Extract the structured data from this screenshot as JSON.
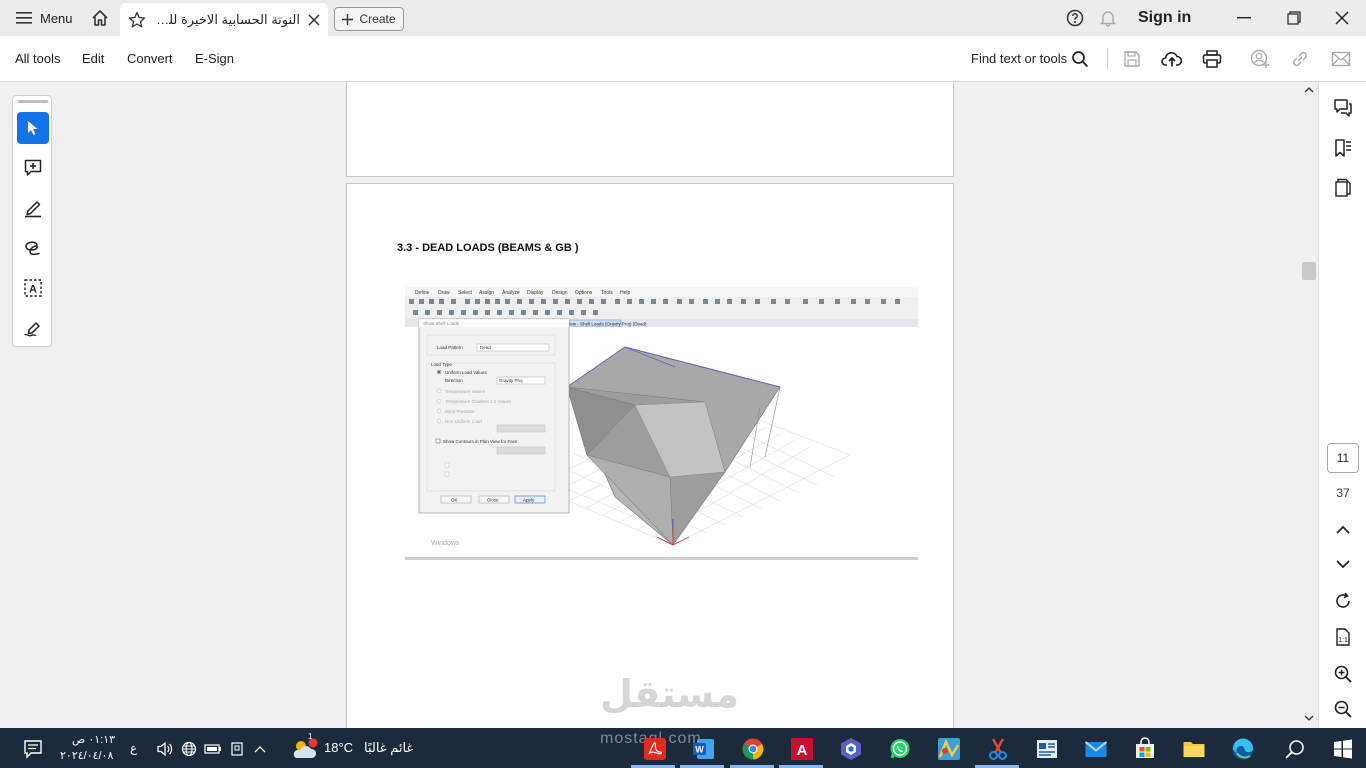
{
  "titlebar": {
    "menu_label": "Menu",
    "tab_title": "النوتة الحسابية الاخيرة للخيمة...",
    "create_label": "Create",
    "signin_label": "Sign in"
  },
  "toolbar": {
    "items": [
      "All tools",
      "Edit",
      "Convert",
      "E-Sign"
    ],
    "find_label": "Find text or tools"
  },
  "document": {
    "heading": "3.3 - DEAD LOADS (BEAMS & GB )",
    "figure": {
      "menu": [
        "Define",
        "Draw",
        "Select",
        "Assign",
        "Analyze",
        "Display",
        "Design",
        "Options",
        "Tools",
        "Help"
      ],
      "dialog_title": "Show Shell Loads",
      "load_pattern_label": "Load Pattern",
      "load_pattern_value": "Dead",
      "load_type_label": "Load Type",
      "uniform_label": "Uniform Load Values",
      "direction_label": "Direction",
      "direction_value": "Gravity Proj",
      "options": [
        "Temperature Values",
        "Temperature Gradient 2-2 Values",
        "Wind Pressure",
        "Non-Uniform Load"
      ],
      "contours_label": "Show Contours in Plan View for Face",
      "ok_label": "OK",
      "close_label": "Close",
      "apply_label": "Apply",
      "view_tab": "3-D View - Shell Loads (Gravity Proj) (Dead)",
      "activate_text": "Windows"
    }
  },
  "navigation": {
    "current_page": "11",
    "total_pages": "37"
  },
  "watermark": {
    "arabic": "مستقل",
    "latin": "mostaql.com"
  },
  "taskbar": {
    "time": "٠١:١٣ ص",
    "date": "٢٠٢٤/٠٤/٠٨",
    "lang": "ع",
    "weather_temp": "18°C",
    "weather_desc": "غائم غالبًا",
    "weather_badge": "1"
  },
  "colors": {
    "accent": "#1473e6",
    "taskbar": "#1c2b3c",
    "acrobat_red": "#e22a1f"
  }
}
